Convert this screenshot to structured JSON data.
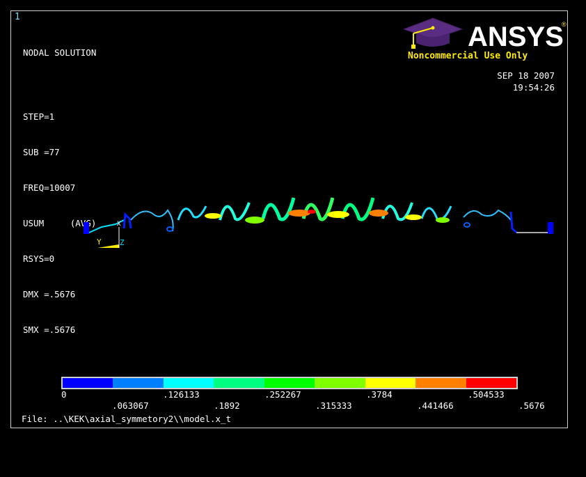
{
  "window_number": "1",
  "info_lines": [
    "NODAL SOLUTION",
    "STEP=1",
    "SUB =77",
    "FREQ=10007",
    "USUM     (AVG)",
    "RSYS=0",
    "DMX =.5676",
    "SMX =.5676"
  ],
  "logo": {
    "text": "ANSYS",
    "registered": "®"
  },
  "noncommercial": "Noncommercial Use Only",
  "date": "SEP 18 2007",
  "time": "19:54:26",
  "triad": {
    "y": "Y",
    "z": "Z",
    "x": "X"
  },
  "legend": {
    "colors": [
      "#0000ff",
      "#0080ff",
      "#00ffff",
      "#00ff80",
      "#00ff00",
      "#80ff00",
      "#ffff00",
      "#ff8000",
      "#ff0000"
    ],
    "labels_top": [
      "0",
      ".126133",
      ".252267",
      ".3784",
      ".504533"
    ],
    "labels_bottom": [
      ".063067",
      ".1892",
      ".315333",
      ".441466",
      ".5676"
    ]
  },
  "file_line": "File: ..\\KEK\\axial_symmetory2\\\\model.x_t"
}
